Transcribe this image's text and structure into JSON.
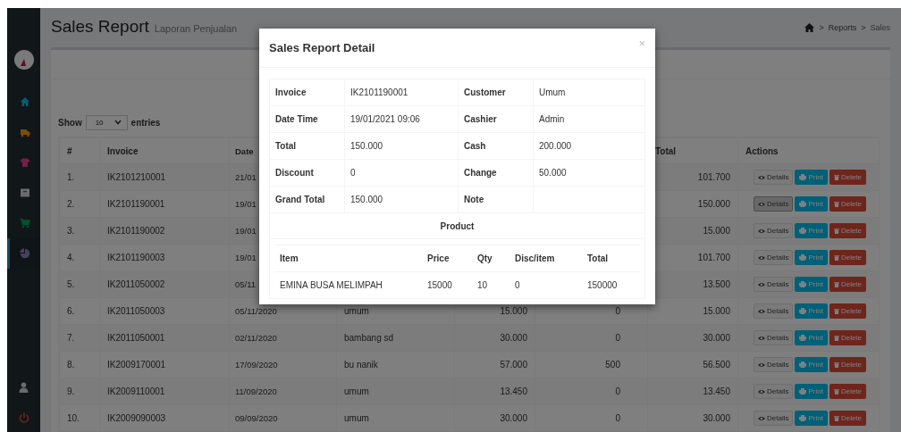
{
  "sidebar": {
    "items": [
      {
        "selected": false
      },
      {
        "selected": false
      },
      {
        "selected": false
      },
      {
        "selected": false
      },
      {
        "selected": false
      },
      {
        "selected": true
      }
    ]
  },
  "page": {
    "title": "Sales Report",
    "subtitle": "Laporan Penjualan",
    "breadcrumb": [
      {
        "separator": ">",
        "label": "Reports"
      },
      {
        "separator": ">",
        "label": "Sales"
      }
    ]
  },
  "length_menu": {
    "label_before": "Show",
    "value": "10",
    "label_after": "entries"
  },
  "table": {
    "columns": [
      "#",
      "Invoice",
      "Date",
      "Total",
      "Actions"
    ],
    "rows": [
      {
        "no": "1.",
        "invoice": "IK2101210001",
        "date": "21/01",
        "grand_total": "101.700",
        "selected": false,
        "details": "Details",
        "print": "Print",
        "delete": "Delete"
      },
      {
        "no": "2.",
        "invoice": "IK2101190001",
        "date": "19/01",
        "grand_total": "150.000",
        "selected": true,
        "details": "Details",
        "print": "Print",
        "delete": "Delete"
      },
      {
        "no": "3.",
        "invoice": "IK2101190002",
        "date": "19/01",
        "grand_total": "15.000",
        "selected": false,
        "details": "Details",
        "print": "Print",
        "delete": "Delete"
      },
      {
        "no": "4.",
        "invoice": "IK2101190003",
        "date": "19/01",
        "grand_total": "101.700",
        "selected": false,
        "details": "Details",
        "print": "Print",
        "delete": "Delete"
      },
      {
        "no": "5.",
        "invoice": "IK2011050002",
        "date": "05/11",
        "grand_total": "13.500",
        "selected": false,
        "details": "Details",
        "print": "Print",
        "delete": "Delete"
      },
      {
        "no": "6.",
        "invoice": "IK2011050003",
        "date": "05/11/2020",
        "customer": "umum",
        "total": "15.000",
        "discount": "0",
        "grand_total": "15.000",
        "selected": false,
        "details": "Details",
        "print": "Print",
        "delete": "Delete"
      },
      {
        "no": "7.",
        "invoice": "IK2011050001",
        "date": "02/11/2020",
        "customer": "bambang sd",
        "total": "30.000",
        "discount": "0",
        "grand_total": "30.000",
        "selected": false,
        "details": "Details",
        "print": "Print",
        "delete": "Delete"
      },
      {
        "no": "8.",
        "invoice": "IK2009170001",
        "date": "17/09/2020",
        "customer": "bu nanik",
        "total": "57.000",
        "discount": "500",
        "grand_total": "56.500",
        "selected": false,
        "details": "Details",
        "print": "Print",
        "delete": "Delete"
      },
      {
        "no": "9.",
        "invoice": "IK2009110001",
        "date": "11/09/2020",
        "customer": "umum",
        "total": "13.450",
        "discount": "0",
        "grand_total": "13.450",
        "selected": false,
        "details": "Details",
        "print": "Print",
        "delete": "Delete"
      },
      {
        "no": "10.",
        "invoice": "IK2009090003",
        "date": "09/09/2020",
        "customer": "umum",
        "total": "30.000",
        "discount": "0",
        "grand_total": "30.000",
        "selected": false,
        "details": "Details",
        "print": "Print",
        "delete": "Delete"
      }
    ]
  },
  "modal": {
    "title": "Sales Report Detail",
    "close": "×",
    "fields": [
      [
        {
          "label": "Invoice",
          "value": "IK2101190001"
        },
        {
          "label": "Customer",
          "value": "Umum"
        }
      ],
      [
        {
          "label": "Date Time",
          "value": "19/01/2021 09:06"
        },
        {
          "label": "Cashier",
          "value": "Admin"
        }
      ],
      [
        {
          "label": "Total",
          "value": "150.000"
        },
        {
          "label": "Cash",
          "value": "200.000"
        }
      ],
      [
        {
          "label": "Discount",
          "value": "0"
        },
        {
          "label": "Change",
          "value": "50.000"
        }
      ],
      [
        {
          "label": "Grand Total",
          "value": "150.000"
        },
        {
          "label": "Note"
        }
      ]
    ],
    "product_heading": "Product",
    "items": {
      "columns": [
        "Item",
        "Price",
        "Qty",
        "Disc/item",
        "Total"
      ],
      "rows": [
        [
          "EMINA BUSA MELIMPAH",
          "15000",
          "10",
          "0",
          "150000"
        ]
      ]
    }
  }
}
